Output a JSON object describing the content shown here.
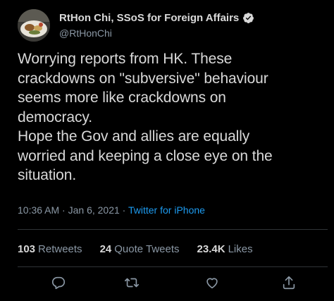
{
  "tweet": {
    "author": {
      "display_name": "RtHon Chi, SSoS for Foreign Affairs",
      "handle": "@RtHonChi",
      "verified_icon": "verified-badge-icon"
    },
    "body_lines": [
      "Worrying reports from HK. These",
      "crackdowns on \"subversive\" behaviour",
      "seems more like crackdowns on",
      "democracy.",
      "Hope the Gov and allies are equally",
      "worried and keeping a close eye on the",
      "situation."
    ],
    "time": "10:36 AM",
    "separator": "·",
    "date": "Jan 6, 2021",
    "source": "Twitter for iPhone",
    "stats": {
      "retweets_count": "103",
      "retweets_label": "Retweets",
      "quotes_count": "24",
      "quotes_label": "Quote Tweets",
      "likes_count": "23.4K",
      "likes_label": "Likes"
    },
    "actions": [
      "reply-icon",
      "retweet-icon",
      "like-icon",
      "share-icon"
    ]
  },
  "colors": {
    "background": "#000000",
    "text": "#D9D9D9",
    "secondary": "#8B98A5",
    "link": "#1D9BF0",
    "divider": "#2F3336"
  }
}
